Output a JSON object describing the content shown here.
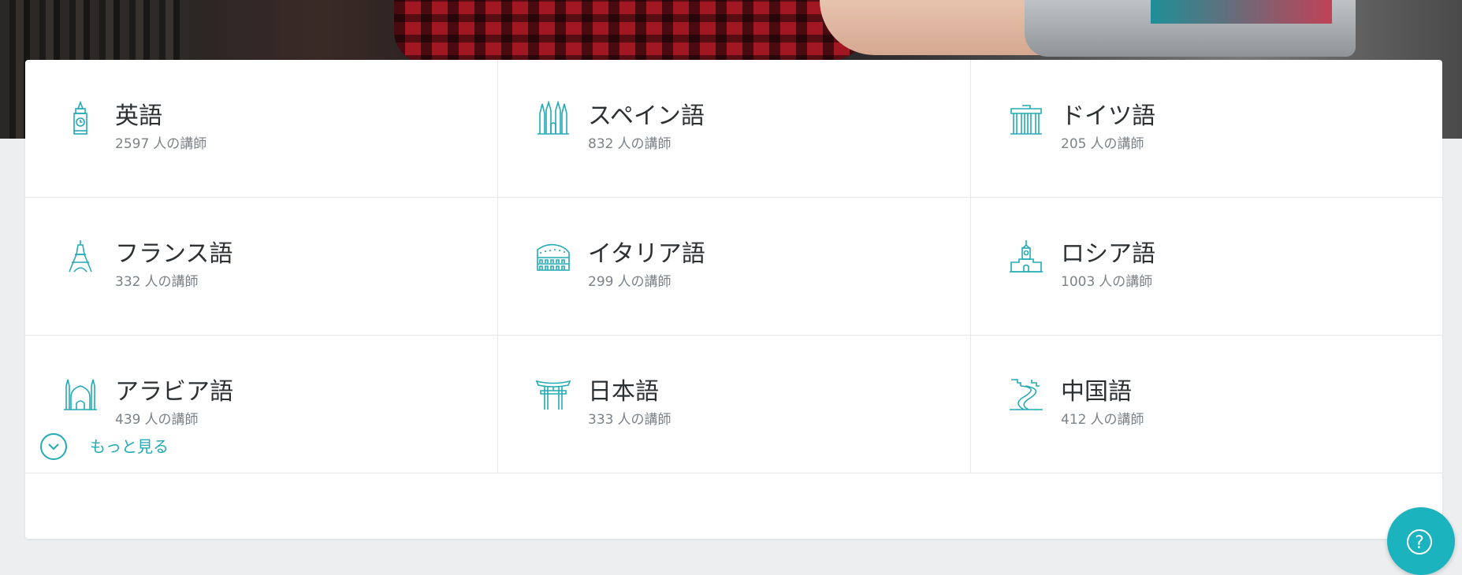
{
  "languages": [
    {
      "name": "英語",
      "count": "2597",
      "icon": "big-ben-icon"
    },
    {
      "name": "スペイン語",
      "count": "832",
      "icon": "sagrada-familia-icon"
    },
    {
      "name": "ドイツ語",
      "count": "205",
      "icon": "brandenburg-gate-icon"
    },
    {
      "name": "フランス語",
      "count": "332",
      "icon": "eiffel-tower-icon"
    },
    {
      "name": "イタリア語",
      "count": "299",
      "icon": "colosseum-icon"
    },
    {
      "name": "ロシア語",
      "count": "1003",
      "icon": "kremlin-icon"
    },
    {
      "name": "アラビア語",
      "count": "439",
      "icon": "mosque-icon"
    },
    {
      "name": "日本語",
      "count": "333",
      "icon": "torii-gate-icon"
    },
    {
      "name": "中国語",
      "count": "412",
      "icon": "great-wall-icon"
    }
  ],
  "count_suffix": "人の講師",
  "more": {
    "label": "もっと見る",
    "icon": "chevron-down-icon"
  },
  "help": {
    "label": "?",
    "icon": "help-icon"
  },
  "colors": {
    "accent": "#23aab4",
    "text": "#2d3033",
    "muted": "#7c8287",
    "help_bg": "#1bb3bd"
  }
}
